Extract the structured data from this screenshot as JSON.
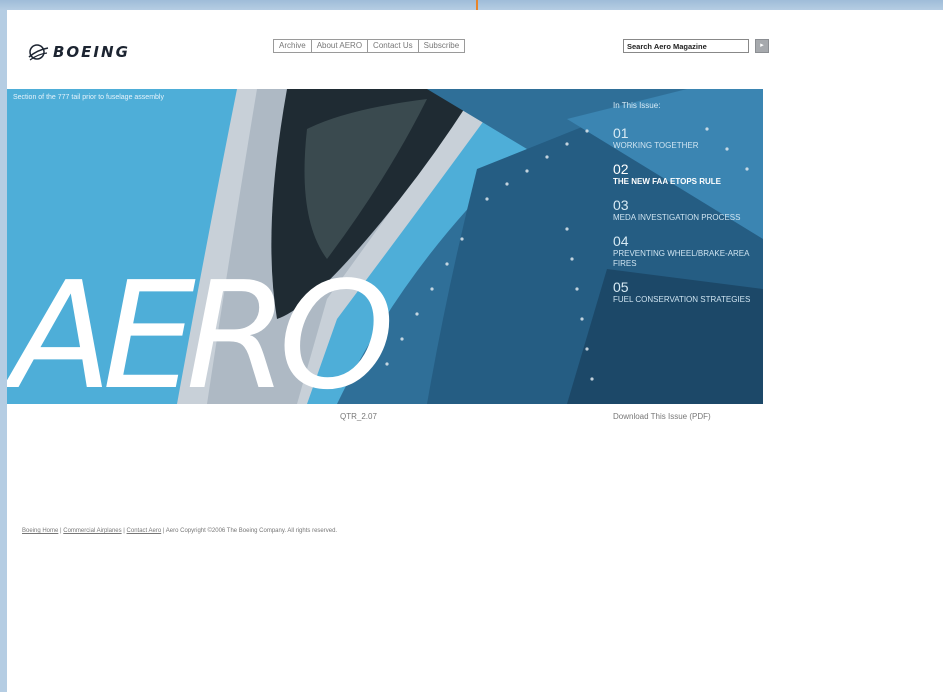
{
  "brand": {
    "logo_text": "BOEING"
  },
  "top_nav": {
    "items": [
      {
        "label": "Archive"
      },
      {
        "label": "About AERO"
      },
      {
        "label": "Contact Us"
      },
      {
        "label": "Subscribe"
      }
    ]
  },
  "search": {
    "placeholder": "Search Aero Magazine",
    "value": "Search Aero Magazine",
    "button_icon": "go-icon"
  },
  "hero": {
    "caption": "Section of the 777 tail prior to fuselage assembly",
    "title": "AERO"
  },
  "issue": {
    "heading": "In This Issue:",
    "articles": [
      {
        "number": "01",
        "title": "WORKING TOGETHER"
      },
      {
        "number": "02",
        "title": "THE NEW FAA ETOPS RULE"
      },
      {
        "number": "03",
        "title": "MEDA INVESTIGATION PROCESS"
      },
      {
        "number": "04",
        "title": "PREVENTING WHEEL/BRAKE-AREA FIRES"
      },
      {
        "number": "05",
        "title": "FUEL CONSERVATION STRATEGIES"
      }
    ],
    "code": "QTR_2.07",
    "download_label": "Download This Issue (PDF)"
  },
  "footer": {
    "links": [
      "Boeing Home",
      "Commercial Airplanes",
      "Contact Aero"
    ],
    "separator": " | ",
    "copyright": "| Aero Copyright ©2006 The Boeing Company. All rights reserved."
  },
  "colors": {
    "accent_arrow": "#e8852a",
    "hero_blue": "#3c9bca"
  }
}
